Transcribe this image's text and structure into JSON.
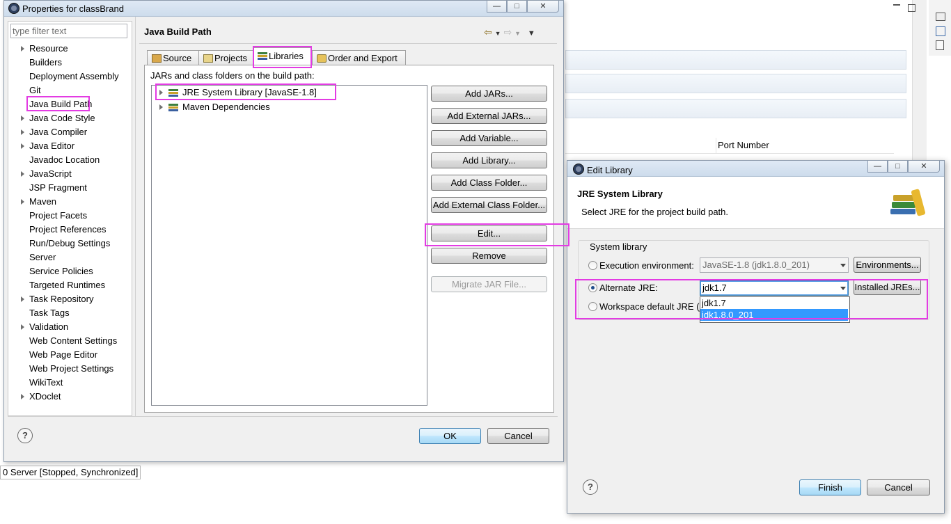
{
  "background": {
    "table_header": "Port Number",
    "server_status": "0 Server  [Stopped, Synchronized]"
  },
  "properties_dialog": {
    "title": "Properties for classBrand",
    "filter_placeholder": "type filter text",
    "tree": [
      {
        "label": "Resource",
        "expandable": true
      },
      {
        "label": "Builders",
        "expandable": false
      },
      {
        "label": "Deployment Assembly",
        "expandable": false
      },
      {
        "label": "Git",
        "expandable": false
      },
      {
        "label": "Java Build Path",
        "expandable": false,
        "selected": true
      },
      {
        "label": "Java Code Style",
        "expandable": true
      },
      {
        "label": "Java Compiler",
        "expandable": true
      },
      {
        "label": "Java Editor",
        "expandable": true
      },
      {
        "label": "Javadoc Location",
        "expandable": false
      },
      {
        "label": "JavaScript",
        "expandable": true
      },
      {
        "label": "JSP Fragment",
        "expandable": false
      },
      {
        "label": "Maven",
        "expandable": true
      },
      {
        "label": "Project Facets",
        "expandable": false
      },
      {
        "label": "Project References",
        "expandable": false
      },
      {
        "label": "Run/Debug Settings",
        "expandable": false
      },
      {
        "label": "Server",
        "expandable": false
      },
      {
        "label": "Service Policies",
        "expandable": false
      },
      {
        "label": "Targeted Runtimes",
        "expandable": false
      },
      {
        "label": "Task Repository",
        "expandable": true
      },
      {
        "label": "Task Tags",
        "expandable": false
      },
      {
        "label": "Validation",
        "expandable": true
      },
      {
        "label": "Web Content Settings",
        "expandable": false
      },
      {
        "label": "Web Page Editor",
        "expandable": false
      },
      {
        "label": "Web Project Settings",
        "expandable": false
      },
      {
        "label": "WikiText",
        "expandable": false
      },
      {
        "label": "XDoclet",
        "expandable": true
      }
    ],
    "page_title": "Java Build Path",
    "tabs": {
      "source": "Source",
      "projects": "Projects",
      "libraries": "Libraries",
      "order": "Order and Export"
    },
    "jars_label": "JARs and class folders on the build path:",
    "jar_items": [
      "JRE System Library [JavaSE-1.8]",
      "Maven Dependencies"
    ],
    "buttons": {
      "add_jars": "Add JARs...",
      "add_external_jars": "Add External JARs...",
      "add_variable": "Add Variable...",
      "add_library": "Add Library...",
      "add_class_folder": "Add Class Folder...",
      "add_external_class_folder": "Add External Class Folder...",
      "edit": "Edit...",
      "remove": "Remove",
      "migrate": "Migrate JAR File...",
      "ok": "OK",
      "cancel": "Cancel"
    }
  },
  "edit_library_dialog": {
    "title": "Edit Library",
    "header_title": "JRE System Library",
    "header_desc": "Select JRE for the project build path.",
    "group_label": "System library",
    "exec_env_label": "Execution environment:",
    "exec_env_value": "JavaSE-1.8 (jdk1.8.0_201)",
    "environments_button": "Environments...",
    "alt_jre_label": "Alternate JRE:",
    "alt_jre_value": "jdk1.7",
    "installed_jres_button": "Installed JREs...",
    "workspace_label": "Workspace default JRE (j",
    "dropdown_options": [
      "jdk1.7",
      "jdk1.8.0_201"
    ],
    "dropdown_selected_index": 1,
    "finish": "Finish",
    "cancel": "Cancel"
  },
  "colors": {
    "highlight": "#e33be3",
    "selection": "#3399ff"
  }
}
